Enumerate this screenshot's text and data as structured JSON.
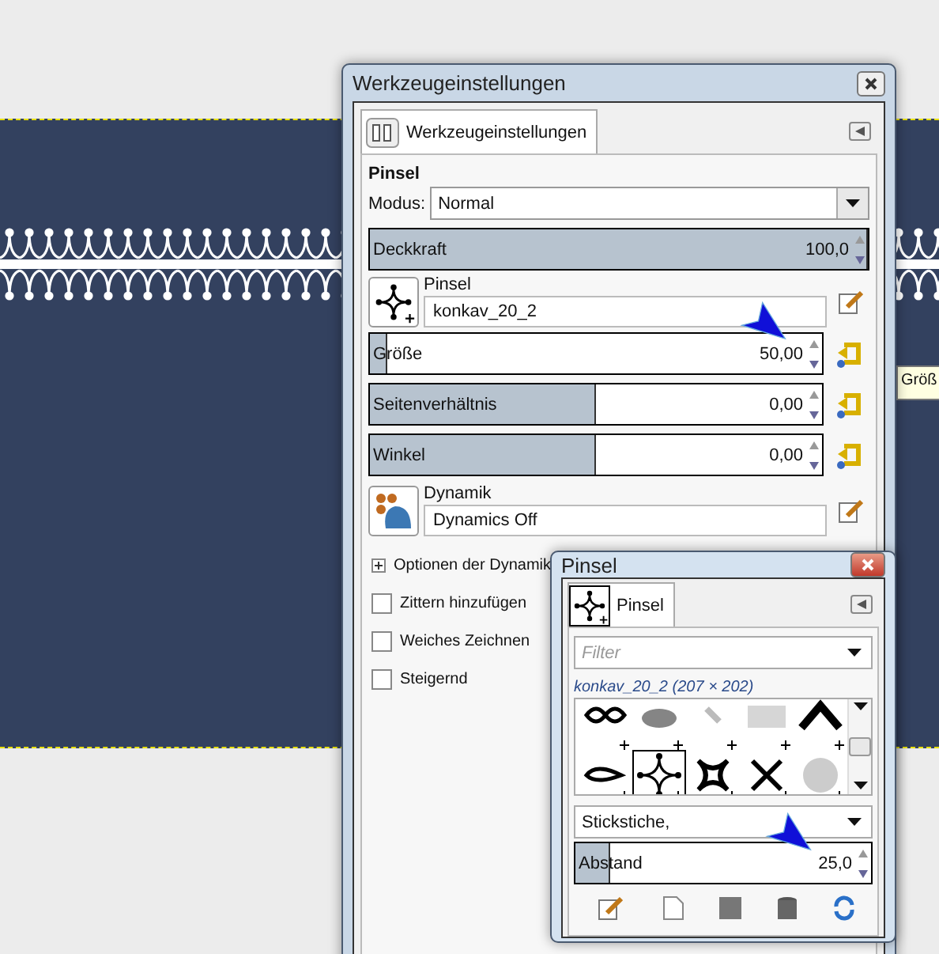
{
  "tooltip": "Größ",
  "tool_options": {
    "title": "Werkzeugeinstellungen",
    "tab": {
      "label": "Werkzeugeinstellungen",
      "selected": true
    },
    "section": "Pinsel",
    "mode": {
      "label": "Modus:",
      "value": "Normal"
    },
    "opacity": {
      "label": "Deckkraft",
      "reading": "100,0",
      "level": 1.0
    },
    "brush": {
      "label": "Pinsel",
      "value": "konkav_20_2"
    },
    "sliders": [
      {
        "label": "Größe",
        "reading": "50,00",
        "level": 0.04
      },
      {
        "label": "Seitenverhältnis",
        "reading": "0,00",
        "level": 0.5
      },
      {
        "label": "Winkel",
        "reading": "0,00",
        "level": 0.5
      }
    ],
    "dynamics": {
      "label": "Dynamik",
      "value": "Dynamics Off"
    },
    "expander": {
      "label": "Optionen der Dynamik",
      "expanded": false
    },
    "options": [
      {
        "label": "Zittern hinzufügen",
        "checked": false
      },
      {
        "label": "Weiches Zeichnen",
        "checked": false
      },
      {
        "label": "Steigernd",
        "checked": false
      }
    ]
  },
  "brushes_dialog": {
    "title": "Pinsel",
    "tab": {
      "label": "Pinsel",
      "selected": true
    },
    "filter_placeholder": "Filter",
    "brush_info": "konkav_20_2 (207 × 202)",
    "brushes": [
      {
        "kind": "infinity",
        "selected": false
      },
      {
        "kind": "blur",
        "selected": false
      },
      {
        "kind": "pin",
        "selected": false
      },
      {
        "kind": "noise",
        "selected": false
      },
      {
        "kind": "chevron",
        "selected": false
      },
      {
        "kind": "drop",
        "selected": false
      },
      {
        "kind": "diamond",
        "selected": true
      },
      {
        "kind": "star",
        "selected": false
      },
      {
        "kind": "cross",
        "selected": false
      },
      {
        "kind": "spray",
        "selected": false
      }
    ],
    "tag": "Stickstiche,",
    "spacing": {
      "label": "Abstand",
      "reading": "25,0",
      "level": 0.12
    }
  }
}
